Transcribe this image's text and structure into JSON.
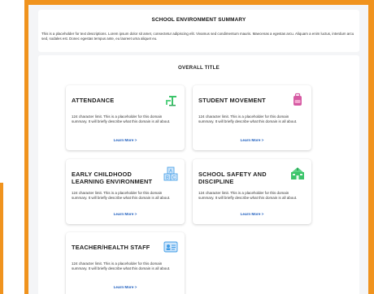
{
  "summary": {
    "title": "SCHOOL ENVIRONMENT SUMMARY",
    "text": "This is a placeholder for text descriptions. Lorem ipsum dolor sit amet, consectetur adipiscing elit. Vivamus sed condimentum mauris. Maecenas a egestas arcu. Aliquam a enim luctus, interdum arcu sed, sodales est. Donec egestas tempus ante, eu laoreet urna aliquet eu."
  },
  "overall": {
    "title": "OVERALL TITLE",
    "cards": [
      {
        "title": "ATTENDANCE",
        "desc": "124 character limit. This is a placeholder for this domain summary. It will briefly describe what this domain is all about.",
        "link": "Learn More >",
        "icon": "desk-chair-icon"
      },
      {
        "title": "STUDENT MOVEMENT",
        "desc": "124 character limit. This is a placeholder for this domain summary. It will briefly describe what this domain is all about.",
        "link": "Learn More >",
        "icon": "backpack-icon"
      },
      {
        "title": "EARLY CHILDHOOD LEARNING ENVIRONMENT",
        "desc": "124 character limit. This is a placeholder for this domain summary. It will briefly describe what this domain is all about.",
        "link": "Learn More >",
        "icon": "abc-blocks-icon"
      },
      {
        "title": "SCHOOL SAFETY AND DISCIPLINE",
        "desc": "124 character limit. This is a placeholder for this domain summary. It will briefly describe what this domain is all about.",
        "link": "Learn More >",
        "icon": "school-building-icon"
      },
      {
        "title": "TEACHER/HEALTH STAFF",
        "desc": "124 character limit. This is a placeholder for this domain summary. It will briefly describe what this domain is all about.",
        "link": "Learn More >",
        "icon": "id-badge-icon"
      }
    ]
  },
  "colors": {
    "frame": "#f0931e",
    "link": "#1f5fbf",
    "icon_green": "#3cc46a",
    "icon_blue": "#3d9be6",
    "icon_pink": "#d65aa3"
  }
}
